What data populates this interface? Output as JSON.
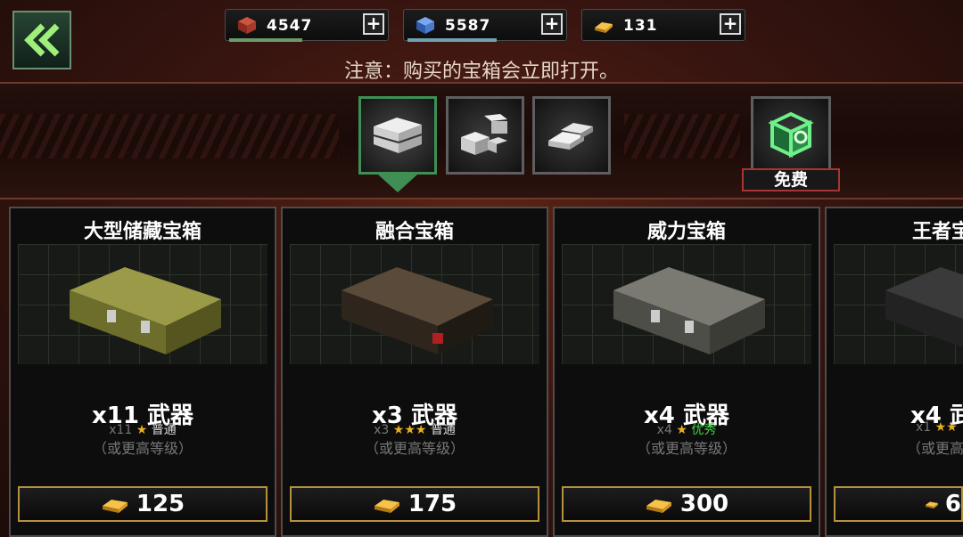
{
  "resources": [
    {
      "name": "red-crate",
      "value": "4547",
      "progress": 0.55,
      "color": "#b03a2e",
      "bar_color": "#6c9a6a"
    },
    {
      "name": "blue-crate",
      "value": "5587",
      "progress": 0.68,
      "color": "#4a7bd0",
      "bar_color": "#6fa0b0"
    },
    {
      "name": "gold-bar",
      "value": "131",
      "progress": 0.0,
      "color": "#e8a524",
      "bar_color": "#c8a040"
    }
  ],
  "notice": "注意：购买的宝箱会立即打开。",
  "tabs": [
    {
      "name": "chest-tab",
      "icon": "chest-icon",
      "active": true
    },
    {
      "name": "parts-tab",
      "icon": "parts-icon",
      "active": false
    },
    {
      "name": "ingots-tab",
      "icon": "ingots-icon",
      "active": false
    }
  ],
  "free_tab": {
    "label": "免费",
    "icon": "free-box-icon"
  },
  "cards": [
    {
      "title": "大型储藏宝箱",
      "count": "x11 武器",
      "rarity_qty": "x11",
      "stars": "★",
      "tier": "普通",
      "tier_color": "normal",
      "hint": "（或更高等级）",
      "price": "125",
      "chest_color": "#7a7a32"
    },
    {
      "title": "融合宝箱",
      "count": "x3 武器",
      "rarity_qty": "x3",
      "stars": "★★★",
      "tier": "普通",
      "tier_color": "normal",
      "hint": "（或更高等级）",
      "price": "175",
      "chest_color": "#3a2e24"
    },
    {
      "title": "威力宝箱",
      "count": "x4 武器",
      "rarity_qty": "x4",
      "stars": "★",
      "tier": "优秀",
      "tier_color": "green",
      "hint": "（或更高等级）",
      "price": "300",
      "chest_color": "#5a5a52"
    },
    {
      "title": "王者宝",
      "count": "x4 武",
      "rarity_qty": "x1",
      "stars": "★★",
      "tier": "",
      "tier_color": "normal",
      "hint": "（或更高",
      "price": "6",
      "chest_color": "#2a2a2a"
    }
  ]
}
